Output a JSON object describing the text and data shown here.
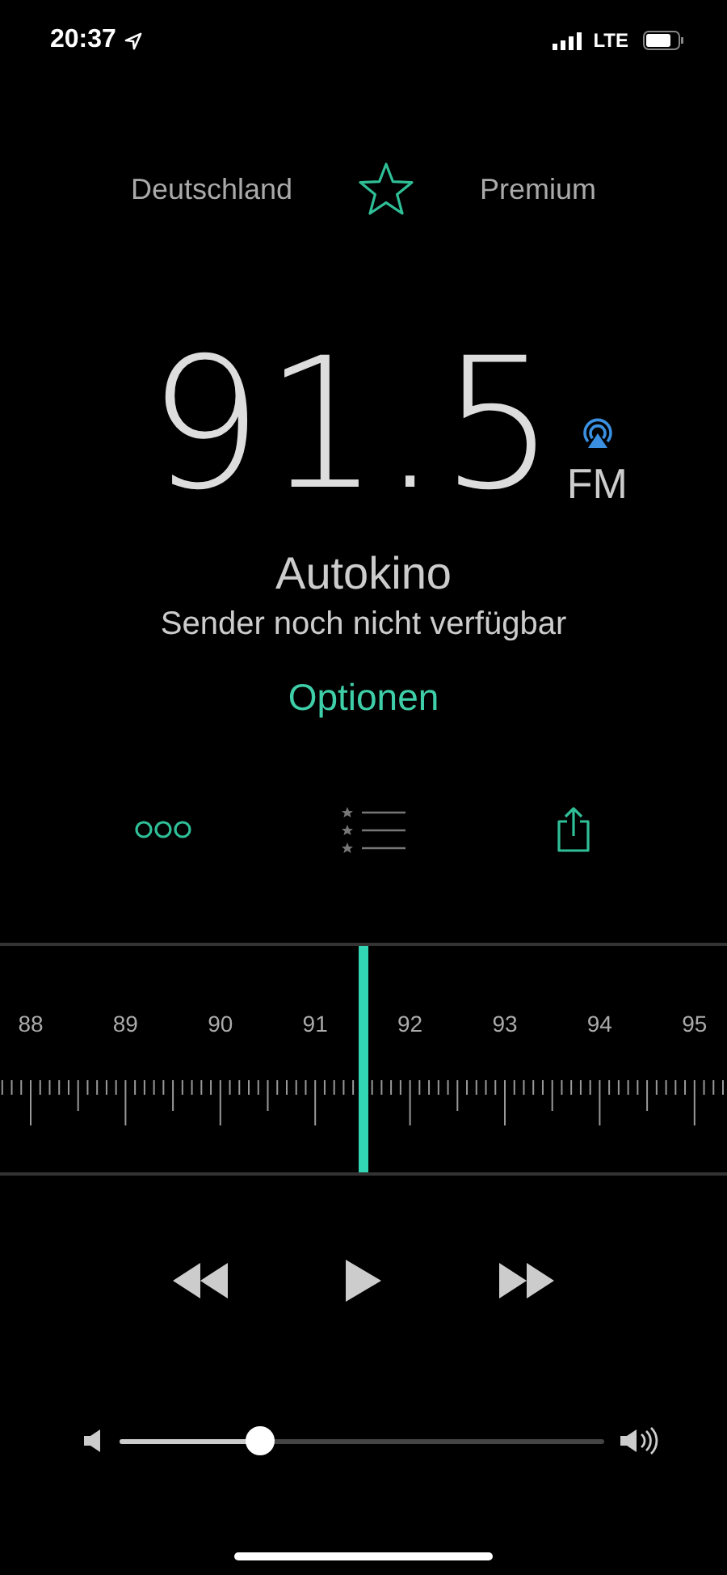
{
  "status_bar": {
    "time": "20:37",
    "network": "LTE"
  },
  "header": {
    "left": "Deutschland",
    "favorite": false,
    "right": "Premium"
  },
  "station": {
    "frequency": "91.5",
    "band": "FM",
    "name": "Autokino",
    "status": "Sender noch nicht verfügbar",
    "options": "Optionen"
  },
  "tuner": {
    "labels": [
      "88",
      "89",
      "90",
      "91",
      "92",
      "93",
      "94",
      "95"
    ],
    "level": 0.5
  },
  "volume": {
    "level": 0.29
  }
}
